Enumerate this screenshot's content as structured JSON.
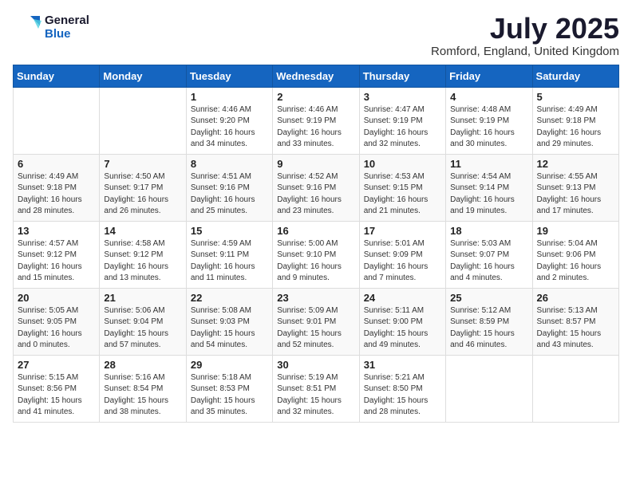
{
  "header": {
    "logo_line1": "General",
    "logo_line2": "Blue",
    "month_title": "July 2025",
    "location": "Romford, England, United Kingdom"
  },
  "days_of_week": [
    "Sunday",
    "Monday",
    "Tuesday",
    "Wednesday",
    "Thursday",
    "Friday",
    "Saturday"
  ],
  "weeks": [
    [
      {
        "day": "",
        "info": ""
      },
      {
        "day": "",
        "info": ""
      },
      {
        "day": "1",
        "info": "Sunrise: 4:46 AM\nSunset: 9:20 PM\nDaylight: 16 hours\nand 34 minutes."
      },
      {
        "day": "2",
        "info": "Sunrise: 4:46 AM\nSunset: 9:19 PM\nDaylight: 16 hours\nand 33 minutes."
      },
      {
        "day": "3",
        "info": "Sunrise: 4:47 AM\nSunset: 9:19 PM\nDaylight: 16 hours\nand 32 minutes."
      },
      {
        "day": "4",
        "info": "Sunrise: 4:48 AM\nSunset: 9:19 PM\nDaylight: 16 hours\nand 30 minutes."
      },
      {
        "day": "5",
        "info": "Sunrise: 4:49 AM\nSunset: 9:18 PM\nDaylight: 16 hours\nand 29 minutes."
      }
    ],
    [
      {
        "day": "6",
        "info": "Sunrise: 4:49 AM\nSunset: 9:18 PM\nDaylight: 16 hours\nand 28 minutes."
      },
      {
        "day": "7",
        "info": "Sunrise: 4:50 AM\nSunset: 9:17 PM\nDaylight: 16 hours\nand 26 minutes."
      },
      {
        "day": "8",
        "info": "Sunrise: 4:51 AM\nSunset: 9:16 PM\nDaylight: 16 hours\nand 25 minutes."
      },
      {
        "day": "9",
        "info": "Sunrise: 4:52 AM\nSunset: 9:16 PM\nDaylight: 16 hours\nand 23 minutes."
      },
      {
        "day": "10",
        "info": "Sunrise: 4:53 AM\nSunset: 9:15 PM\nDaylight: 16 hours\nand 21 minutes."
      },
      {
        "day": "11",
        "info": "Sunrise: 4:54 AM\nSunset: 9:14 PM\nDaylight: 16 hours\nand 19 minutes."
      },
      {
        "day": "12",
        "info": "Sunrise: 4:55 AM\nSunset: 9:13 PM\nDaylight: 16 hours\nand 17 minutes."
      }
    ],
    [
      {
        "day": "13",
        "info": "Sunrise: 4:57 AM\nSunset: 9:12 PM\nDaylight: 16 hours\nand 15 minutes."
      },
      {
        "day": "14",
        "info": "Sunrise: 4:58 AM\nSunset: 9:12 PM\nDaylight: 16 hours\nand 13 minutes."
      },
      {
        "day": "15",
        "info": "Sunrise: 4:59 AM\nSunset: 9:11 PM\nDaylight: 16 hours\nand 11 minutes."
      },
      {
        "day": "16",
        "info": "Sunrise: 5:00 AM\nSunset: 9:10 PM\nDaylight: 16 hours\nand 9 minutes."
      },
      {
        "day": "17",
        "info": "Sunrise: 5:01 AM\nSunset: 9:09 PM\nDaylight: 16 hours\nand 7 minutes."
      },
      {
        "day": "18",
        "info": "Sunrise: 5:03 AM\nSunset: 9:07 PM\nDaylight: 16 hours\nand 4 minutes."
      },
      {
        "day": "19",
        "info": "Sunrise: 5:04 AM\nSunset: 9:06 PM\nDaylight: 16 hours\nand 2 minutes."
      }
    ],
    [
      {
        "day": "20",
        "info": "Sunrise: 5:05 AM\nSunset: 9:05 PM\nDaylight: 16 hours\nand 0 minutes."
      },
      {
        "day": "21",
        "info": "Sunrise: 5:06 AM\nSunset: 9:04 PM\nDaylight: 15 hours\nand 57 minutes."
      },
      {
        "day": "22",
        "info": "Sunrise: 5:08 AM\nSunset: 9:03 PM\nDaylight: 15 hours\nand 54 minutes."
      },
      {
        "day": "23",
        "info": "Sunrise: 5:09 AM\nSunset: 9:01 PM\nDaylight: 15 hours\nand 52 minutes."
      },
      {
        "day": "24",
        "info": "Sunrise: 5:11 AM\nSunset: 9:00 PM\nDaylight: 15 hours\nand 49 minutes."
      },
      {
        "day": "25",
        "info": "Sunrise: 5:12 AM\nSunset: 8:59 PM\nDaylight: 15 hours\nand 46 minutes."
      },
      {
        "day": "26",
        "info": "Sunrise: 5:13 AM\nSunset: 8:57 PM\nDaylight: 15 hours\nand 43 minutes."
      }
    ],
    [
      {
        "day": "27",
        "info": "Sunrise: 5:15 AM\nSunset: 8:56 PM\nDaylight: 15 hours\nand 41 minutes."
      },
      {
        "day": "28",
        "info": "Sunrise: 5:16 AM\nSunset: 8:54 PM\nDaylight: 15 hours\nand 38 minutes."
      },
      {
        "day": "29",
        "info": "Sunrise: 5:18 AM\nSunset: 8:53 PM\nDaylight: 15 hours\nand 35 minutes."
      },
      {
        "day": "30",
        "info": "Sunrise: 5:19 AM\nSunset: 8:51 PM\nDaylight: 15 hours\nand 32 minutes."
      },
      {
        "day": "31",
        "info": "Sunrise: 5:21 AM\nSunset: 8:50 PM\nDaylight: 15 hours\nand 28 minutes."
      },
      {
        "day": "",
        "info": ""
      },
      {
        "day": "",
        "info": ""
      }
    ]
  ]
}
